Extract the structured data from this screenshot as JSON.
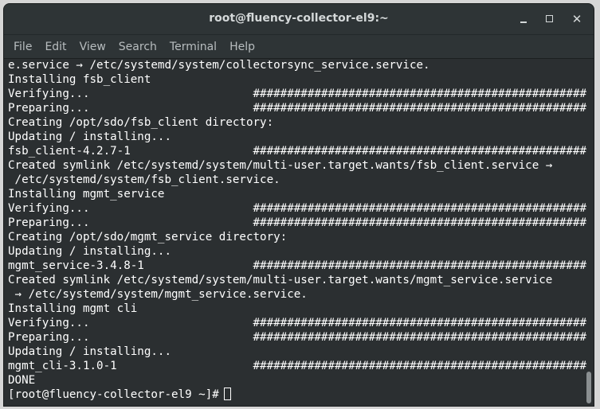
{
  "window": {
    "title": "root@fluency-collector-el9:~",
    "minimize_icon": "minimize-icon",
    "maximize_icon": "maximize-icon",
    "close_icon": "close-icon"
  },
  "menu": {
    "items": [
      "File",
      "Edit",
      "View",
      "Search",
      "Terminal",
      "Help"
    ]
  },
  "terminal": {
    "lines": [
      "e.service → /etc/systemd/system/collectorsync_service.service.",
      "Installing fsb_client",
      "Verifying...                        #################################################",
      "Preparing...                        #################################################",
      "Creating /opt/sdo/fsb_client directory:",
      "Updating / installing...",
      "fsb_client-4.2.7-1                  #################################################",
      "Created symlink /etc/systemd/system/multi-user.target.wants/fsb_client.service →",
      " /etc/systemd/system/fsb_client.service.",
      "Installing mgmt_service",
      "Verifying...                        #################################################",
      "Preparing...                        #################################################",
      "Creating /opt/sdo/mgmt_service directory:",
      "Updating / installing...",
      "mgmt_service-3.4.8-1                #################################################",
      "Created symlink /etc/systemd/system/multi-user.target.wants/mgmt_service.service",
      " → /etc/systemd/system/mgmt_service.service.",
      "Installing mgmt cli",
      "Verifying...                        #################################################",
      "Preparing...                        #################################################",
      "Updating / installing...",
      "mgmt_cli-3.1.0-1                    #################################################",
      "DONE"
    ],
    "prompt": "[root@fluency-collector-el9 ~]#"
  },
  "colors": {
    "background": "#2b2f31",
    "foreground": "#ffffff",
    "titlebar": "#2e3436"
  }
}
